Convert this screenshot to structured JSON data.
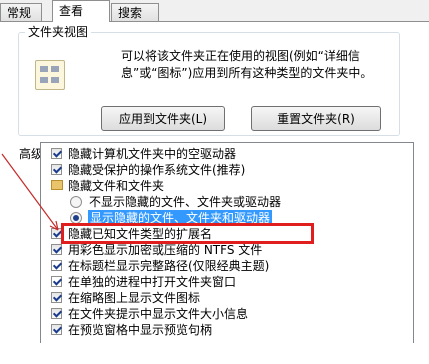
{
  "tabs": [
    "常规",
    "查看",
    "搜索"
  ],
  "folder_views": {
    "title": "文件夹视图",
    "description": "可以将该文件夹正在使用的视图(例如“详细信息”或“图标”)应用到所有这种类型的文件夹中。",
    "apply_button": "应用到文件夹(L)",
    "reset_button": "重置文件夹(R)"
  },
  "advanced": {
    "label": "高级设置:",
    "items": [
      {
        "type": "checkbox",
        "checked": true,
        "label": "隐藏计算机文件夹中的空驱动器"
      },
      {
        "type": "checkbox",
        "checked": true,
        "label": "隐藏受保护的操作系统文件(推荐)"
      },
      {
        "type": "folder",
        "label": "隐藏文件和文件夹"
      },
      {
        "type": "radio",
        "checked": false,
        "label": "不显示隐藏的文件、文件夹或驱动器"
      },
      {
        "type": "radio",
        "checked": true,
        "label": "显示隐藏的文件、文件夹和驱动器"
      },
      {
        "type": "checkbox",
        "checked": true,
        "label": "隐藏已知文件类型的扩展名"
      },
      {
        "type": "checkbox",
        "checked": true,
        "label": "用彩色显示加密或压缩的 NTFS 文件"
      },
      {
        "type": "checkbox",
        "checked": false,
        "label": "在标题栏显示完整路径(仅限经典主题)"
      },
      {
        "type": "checkbox",
        "checked": false,
        "label": "在单独的进程中打开文件夹窗口"
      },
      {
        "type": "checkbox",
        "checked": true,
        "label": "在缩略图上显示文件图标"
      },
      {
        "type": "checkbox",
        "checked": true,
        "label": "在文件夹提示中显示文件大小信息"
      },
      {
        "type": "checkbox",
        "checked": true,
        "label": "在预览窗格中显示预览句柄"
      }
    ]
  },
  "colors": {
    "highlight": "#3399ff",
    "annotation": "#e01e1e"
  }
}
